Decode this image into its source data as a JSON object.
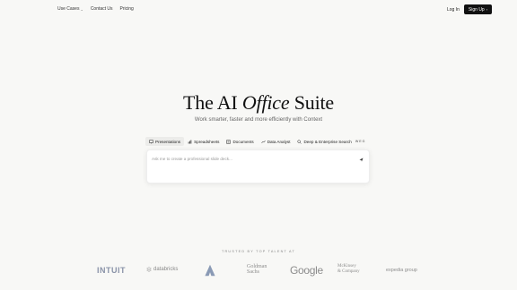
{
  "nav": {
    "links": [
      {
        "label": "Use Cases",
        "has_dropdown": true
      },
      {
        "label": "Contact Us",
        "has_dropdown": false
      },
      {
        "label": "Pricing",
        "has_dropdown": false
      }
    ],
    "login_label": "Log In",
    "signup_label": "Sign Up",
    "signup_icon": "arrow-right-icon"
  },
  "hero": {
    "title_pre": "The AI",
    "title_italic": "Office",
    "title_post": "Suite",
    "subtitle": "Work smarter, faster and more efficiently with Context"
  },
  "tabs": [
    {
      "label": "Presentations",
      "icon": "presentation-icon",
      "active": true
    },
    {
      "label": "Spreadsheets",
      "icon": "spreadsheet-icon",
      "active": false
    },
    {
      "label": "Documents",
      "icon": "document-icon",
      "active": false
    },
    {
      "label": "Data Analyst",
      "icon": "data-analyst-icon",
      "active": false
    },
    {
      "label": "Deep & Enterprise Search",
      "icon": "search-icon",
      "active": false
    }
  ],
  "tab_badges": [
    "W",
    "E",
    "G"
  ],
  "prompt": {
    "placeholder": "Ask me to create a professional slide deck...",
    "send_icon": "send-icon"
  },
  "trusted": {
    "label": "TRUSTED BY TOP TALENT AT",
    "logos": [
      {
        "name": "INTUIT"
      },
      {
        "name": "databricks"
      },
      {
        "name": "Atlassian"
      },
      {
        "name_line1": "Goldman",
        "name_line2": "Sachs"
      },
      {
        "name": "Google"
      },
      {
        "name_line1": "McKinsey",
        "name_line2": "& Company"
      },
      {
        "name": "expedia group"
      }
    ]
  },
  "colors": {
    "background": "#f8f8f6",
    "primary_button": "#111111",
    "muted_text": "#666666",
    "logo_gray": "#8c8c8c"
  }
}
